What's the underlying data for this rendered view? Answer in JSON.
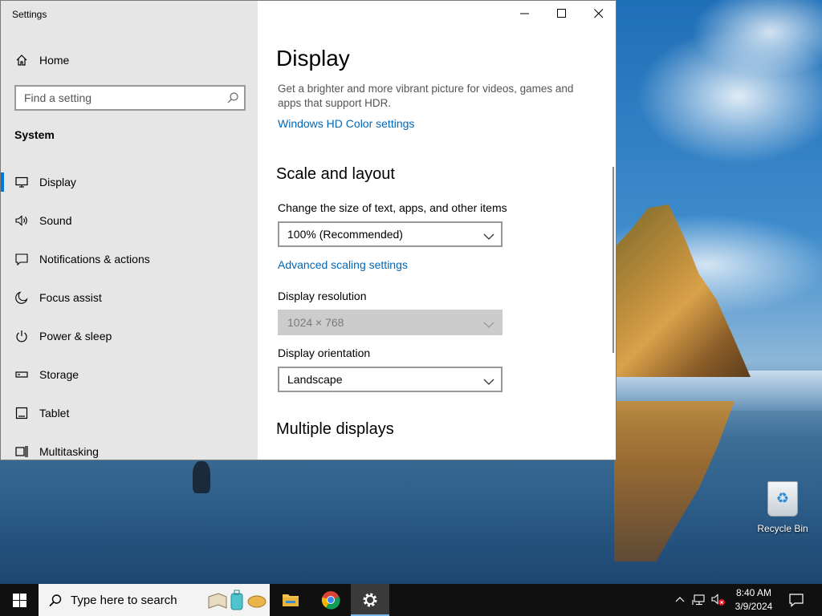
{
  "window": {
    "title": "Settings"
  },
  "sidebar": {
    "home_label": "Home",
    "search_placeholder": "Find a setting",
    "section": "System",
    "items": [
      {
        "label": "Display",
        "icon": "monitor-icon",
        "selected": true
      },
      {
        "label": "Sound",
        "icon": "speaker-icon"
      },
      {
        "label": "Notifications & actions",
        "icon": "message-icon"
      },
      {
        "label": "Focus assist",
        "icon": "moon-icon"
      },
      {
        "label": "Power & sleep",
        "icon": "power-icon"
      },
      {
        "label": "Storage",
        "icon": "storage-icon"
      },
      {
        "label": "Tablet",
        "icon": "tablet-icon"
      },
      {
        "label": "Multitasking",
        "icon": "multitasking-icon"
      }
    ]
  },
  "content": {
    "title": "Display",
    "hdr_description": "Get a brighter and more vibrant picture for videos, games and apps that support HDR.",
    "hdr_link": "Windows HD Color settings",
    "scale_heading": "Scale and layout",
    "scale_label": "Change the size of text, apps, and other items",
    "scale_value": "100% (Recommended)",
    "advanced_link": "Advanced scaling settings",
    "resolution_label": "Display resolution",
    "resolution_value": "1024 × 768",
    "orientation_label": "Display orientation",
    "orientation_value": "Landscape",
    "multiple_heading": "Multiple displays"
  },
  "desktop": {
    "recycle_bin_label": "Recycle Bin"
  },
  "taskbar": {
    "search_placeholder": "Type here to search",
    "apps": [
      "file-explorer-icon",
      "chrome-icon",
      "settings-gear-icon"
    ],
    "active_app": "Settings",
    "time": "8:40 AM",
    "date": "3/9/2024"
  },
  "colors": {
    "accent": "#0078d7",
    "link": "#0067b8",
    "sidebar_bg": "#e6e6e6",
    "taskbar_bg": "#101010"
  }
}
